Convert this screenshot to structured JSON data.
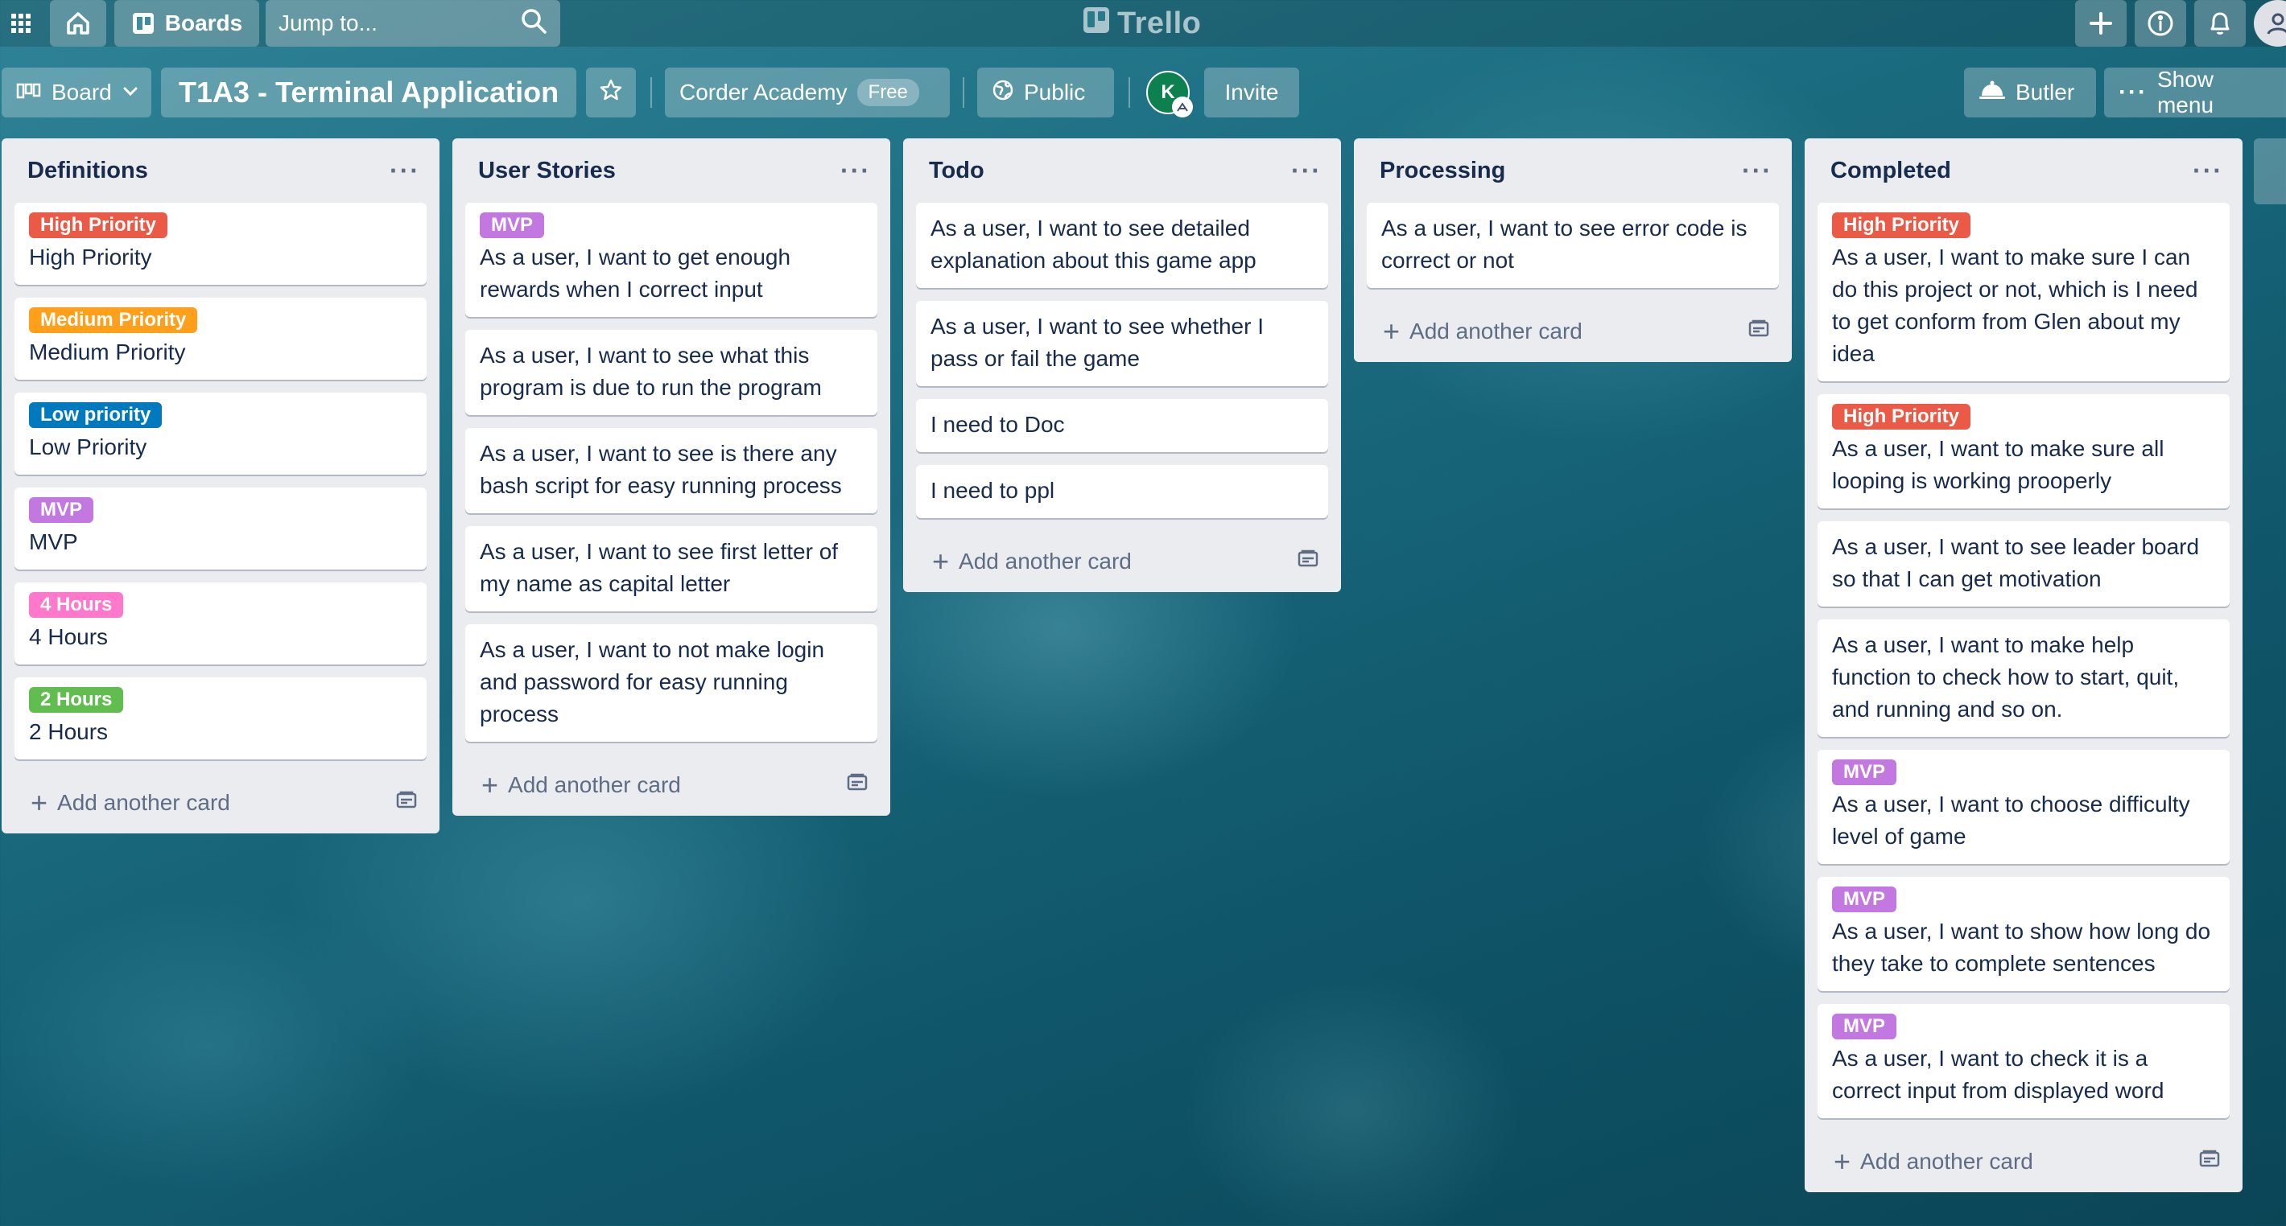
{
  "header": {
    "apps_icon": "grid-icon",
    "home_icon": "home-icon",
    "boards_label": "Boards",
    "search_placeholder": "Jump to...",
    "logo_text": "Trello",
    "right_icons": [
      "plus-icon",
      "info-icon",
      "bell-icon",
      "user-icon"
    ]
  },
  "board_header": {
    "view_label": "Board",
    "title": "T1A3 - Terminal Application",
    "workspace": "Corder Academy",
    "workspace_badge": "Free",
    "visibility": "Public",
    "member_initial": "K",
    "invite_label": "Invite",
    "butler_label": "Butler",
    "show_menu_label": "Show menu"
  },
  "add_card_label": "Add another card",
  "label_colors": {
    "red": "#eb5a46",
    "orange": "#ff9f1a",
    "blue": "#0079bf",
    "purple": "#c377e0",
    "pink": "#ff78cb",
    "green": "#61bd4f"
  },
  "lists": [
    {
      "title": "Definitions",
      "cards": [
        {
          "label": "High Priority",
          "label_color": "#eb5a46",
          "text": "High Priority"
        },
        {
          "label": "Medium Priority",
          "label_color": "#ff9f1a",
          "text": "Medium Priority"
        },
        {
          "label": "Low priority",
          "label_color": "#0079bf",
          "text": "Low Priority"
        },
        {
          "label": "MVP",
          "label_color": "#c377e0",
          "text": "MVP"
        },
        {
          "label": "4 Hours",
          "label_color": "#ff78cb",
          "text": "4 Hours"
        },
        {
          "label": "2 Hours",
          "label_color": "#61bd4f",
          "text": "2 Hours"
        }
      ]
    },
    {
      "title": "User Stories",
      "cards": [
        {
          "label": "MVP",
          "label_color": "#c377e0",
          "text": "As a user, I want to get enough rewards when I correct input"
        },
        {
          "label": "",
          "label_color": "",
          "text": "As a user, I want to see what this program is due to run the program"
        },
        {
          "label": "",
          "label_color": "",
          "text": "As a user, I want to see is there any bash script for easy running process"
        },
        {
          "label": "",
          "label_color": "",
          "text": "As a user, I want to see first letter of my name as capital letter"
        },
        {
          "label": "",
          "label_color": "",
          "text": "As a user, I want to not make login and password for easy running process"
        }
      ]
    },
    {
      "title": "Todo",
      "cards": [
        {
          "label": "",
          "label_color": "",
          "text": "As a user, I want to see detailed explanation about this game app"
        },
        {
          "label": "",
          "label_color": "",
          "text": "As a user, I want to see whether I pass or fail the game"
        },
        {
          "label": "",
          "label_color": "",
          "text": "I need to Doc"
        },
        {
          "label": "",
          "label_color": "",
          "text": "I need to ppl"
        }
      ]
    },
    {
      "title": "Processing",
      "cards": [
        {
          "label": "",
          "label_color": "",
          "text": "As a user, I want to see error code is correct or not"
        }
      ]
    },
    {
      "title": "Completed",
      "cards": [
        {
          "label": "High Priority",
          "label_color": "#eb5a46",
          "text": "As a user, I want to make sure I can do this project or not, which is I need to get conform from Glen about my idea"
        },
        {
          "label": "High Priority",
          "label_color": "#eb5a46",
          "text": "As a user, I want to make sure all looping is working prooperly"
        },
        {
          "label": "",
          "label_color": "",
          "text": "As a user, I want to see leader board so that I can get motivation"
        },
        {
          "label": "",
          "label_color": "",
          "text": "As a user, I want to make help function to check how to start, quit, and running and so on."
        },
        {
          "label": "MVP",
          "label_color": "#c377e0",
          "text": "As a user, I want to choose difficulty level of game"
        },
        {
          "label": "MVP",
          "label_color": "#c377e0",
          "text": "As a user, I want to show how long do they take to complete sentences"
        },
        {
          "label": "MVP",
          "label_color": "#c377e0",
          "text": "As a user, I want to check it is a correct input from displayed word"
        }
      ]
    }
  ]
}
